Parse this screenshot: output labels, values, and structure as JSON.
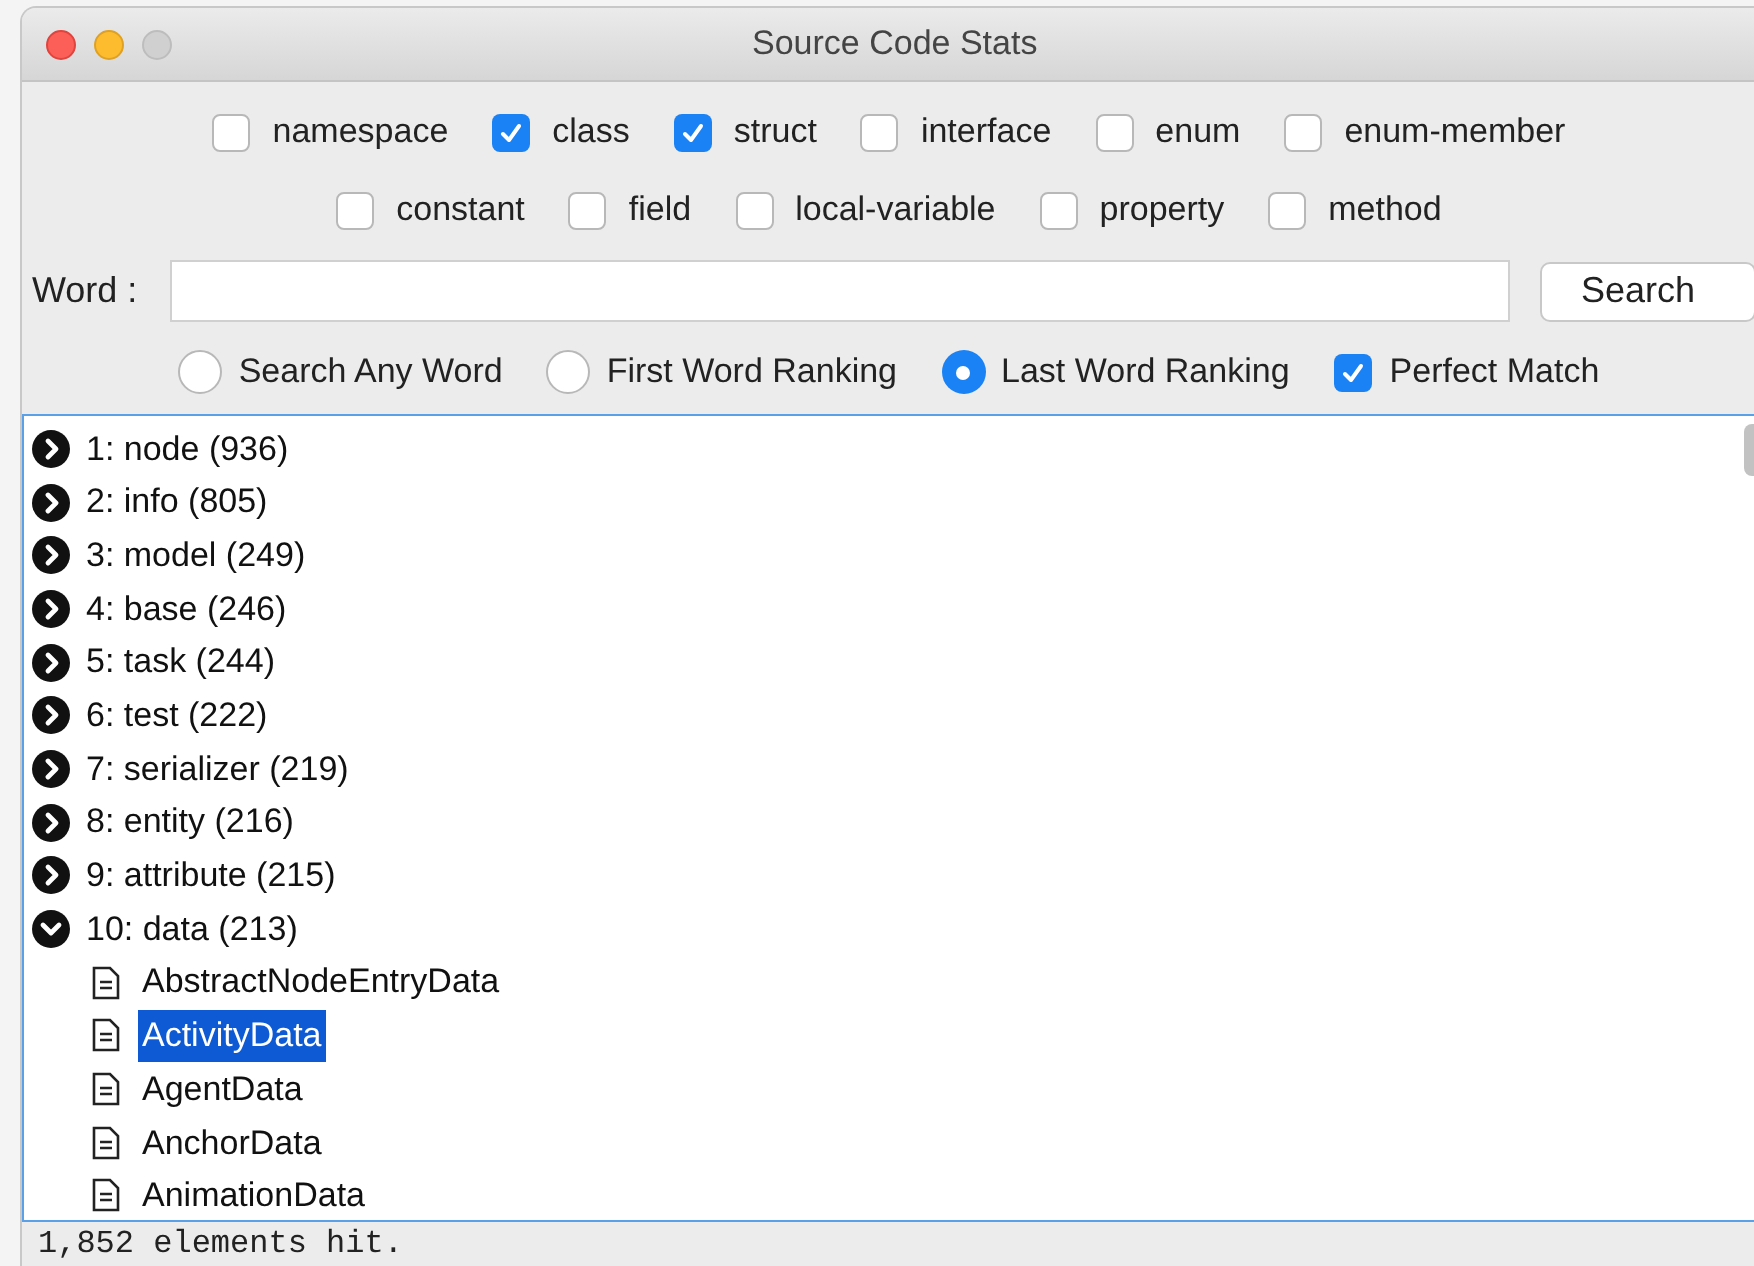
{
  "window": {
    "title": "Source Code Stats"
  },
  "filters": [
    [
      {
        "label": "namespace",
        "checked": false
      },
      {
        "label": "class",
        "checked": true
      },
      {
        "label": "struct",
        "checked": true
      },
      {
        "label": "interface",
        "checked": false
      },
      {
        "label": "enum",
        "checked": false
      },
      {
        "label": "enum-member",
        "checked": false
      }
    ],
    [
      {
        "label": "constant",
        "checked": false
      },
      {
        "label": "field",
        "checked": false
      },
      {
        "label": "local-variable",
        "checked": false
      },
      {
        "label": "property",
        "checked": false
      },
      {
        "label": "method",
        "checked": false
      }
    ]
  ],
  "word": {
    "label": "Word :"
  },
  "search_button": "Search",
  "modes": [
    {
      "label": "Search Any Word",
      "selected": false
    },
    {
      "label": "First Word Ranking",
      "selected": false
    },
    {
      "label": "Last Word Ranking",
      "selected": true
    }
  ],
  "perfect_match": {
    "label": "Perfect Match",
    "checked": true
  },
  "tree": [
    {
      "label": "1: node (936)",
      "expanded": false
    },
    {
      "label": "2: info (805)",
      "expanded": false
    },
    {
      "label": "3: model (249)",
      "expanded": false
    },
    {
      "label": "4: base (246)",
      "expanded": false
    },
    {
      "label": "5: task (244)",
      "expanded": false
    },
    {
      "label": "6: test (222)",
      "expanded": false
    },
    {
      "label": "7: serializer (219)",
      "expanded": false
    },
    {
      "label": "8: entity (216)",
      "expanded": false
    },
    {
      "label": "9: attribute (215)",
      "expanded": false
    },
    {
      "label": "10: data (213)",
      "expanded": true,
      "children": [
        {
          "label": "AbstractNodeEntryData",
          "selected": false
        },
        {
          "label": "ActivityData",
          "selected": true
        },
        {
          "label": "AgentData",
          "selected": false
        },
        {
          "label": "AnchorData",
          "selected": false
        },
        {
          "label": "AnimationData",
          "selected": false
        }
      ]
    }
  ],
  "status_bar": "1,852 elements hit."
}
